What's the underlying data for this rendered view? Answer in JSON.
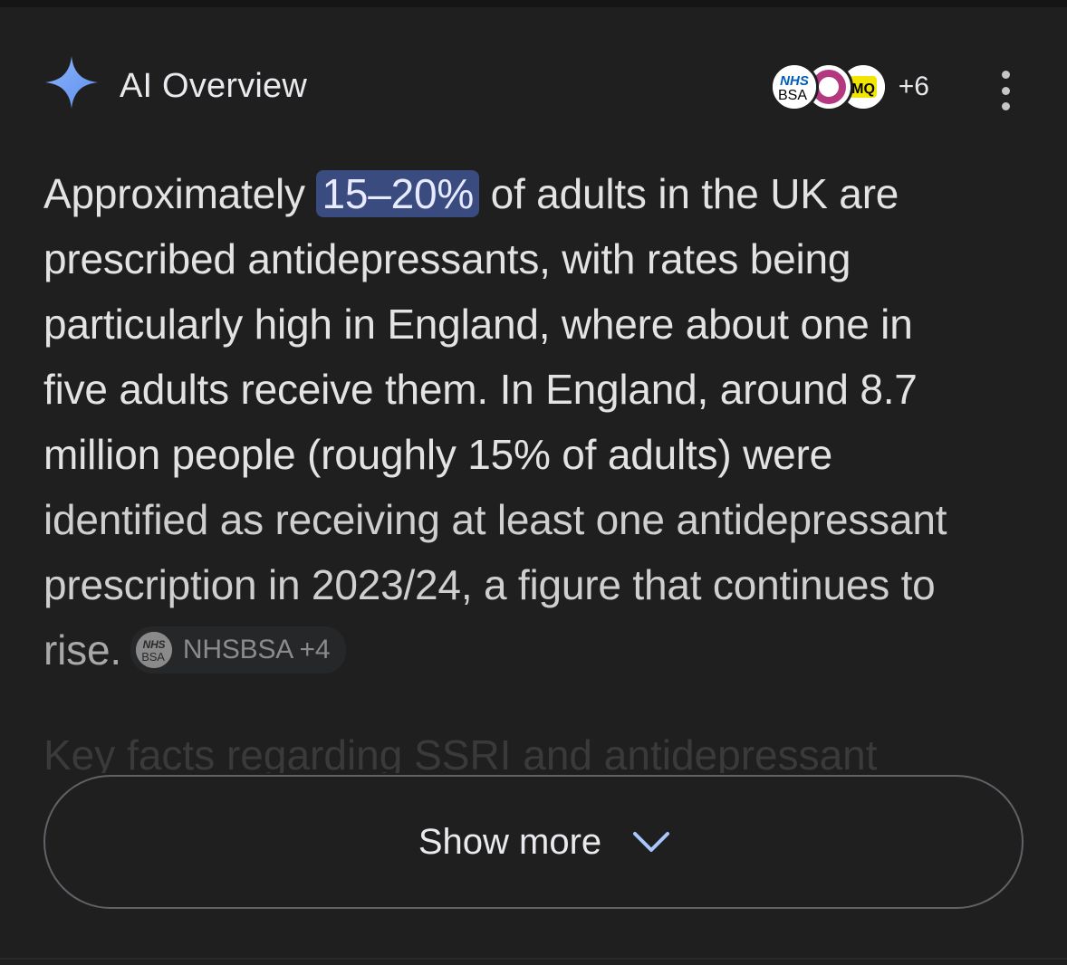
{
  "header": {
    "title": "AI Overview",
    "sources_more": "+6",
    "source_logos": [
      {
        "name": "nhsbsa-logo",
        "text_top": "NHS",
        "text_bottom": "BSA"
      },
      {
        "name": "c-logo",
        "text": "C"
      },
      {
        "name": "mq-logo",
        "text": "MQ"
      }
    ]
  },
  "body": {
    "line1_pre": "Approximately ",
    "highlight": "15–20%",
    "line1_post": " of adults in the UK are",
    "line2": "prescribed antidepressants, with rates being",
    "line3": "particularly high in England, where about one in",
    "line4": "five adults receive them. In England, around 8.7",
    "line5": "million people (roughly 15% of adults) were",
    "line6": "identified as receiving at least one antidepressant",
    "line7": "prescription in 2023/24, a figure that continues to",
    "line8": "rise.",
    "chip_label": "NHSBSA +4",
    "chip_logo_top": "NHS",
    "chip_logo_bottom": "BSA",
    "faded_heading": "Key facts regarding SSRI and antidepressant"
  },
  "show_more": {
    "label": "Show more"
  },
  "colors": {
    "background": "#1f1f1f",
    "highlight": "#394b7f",
    "sparkle": "#7ea7f5",
    "chevron": "#a8c7fa"
  }
}
